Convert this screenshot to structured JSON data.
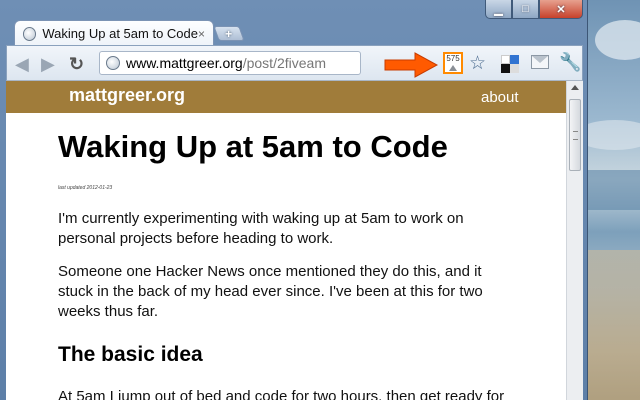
{
  "window": {
    "controls": {
      "minimize": "▁",
      "maximize": "□",
      "close": "✕"
    }
  },
  "tab": {
    "title": "Waking Up at 5am to Code",
    "close": "×",
    "favicon": "globe-icon"
  },
  "new_tab": {
    "label": "+"
  },
  "toolbar": {
    "back": "◀",
    "forward": "▶",
    "reload": "↻",
    "address": {
      "host": "www.mattgreer.org",
      "path": "/post/2fiveam"
    },
    "counter_extension": {
      "count": "575"
    },
    "bookmark_star": "☆",
    "wrench": "🔧",
    "annotation_color": "#ff5a00"
  },
  "site": {
    "name": "mattgreer.org",
    "nav_about": "about",
    "header_color": "#a07c3a"
  },
  "post": {
    "title": "Waking Up at 5am to Code",
    "last_updated": "last updated 2012-01-23",
    "paragraphs": [
      "I'm currently experimenting with waking up at 5am to work on personal projects before heading to work.",
      "Someone one Hacker News once mentioned they do this, and it stuck in the back of my head ever since. I've been at this for two weeks thus far."
    ],
    "heading": "The basic idea",
    "partial_paragraph": "At 5am I jump out of bed and code for two hours, then get ready for"
  }
}
